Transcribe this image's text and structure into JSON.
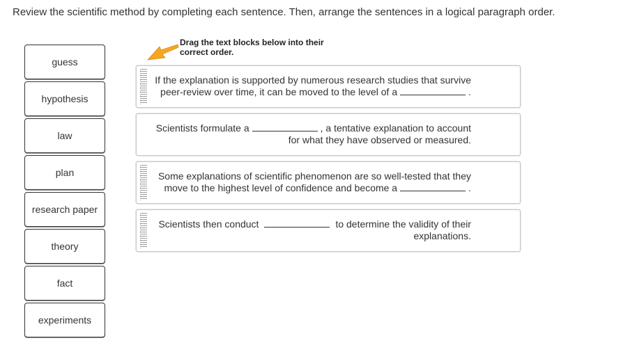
{
  "instructions": "Review the scientific method by completing each sentence. Then, arrange the sentences in a logical paragraph order.",
  "drag_hint": "Drag the text blocks below into their correct order.",
  "word_bank": [
    "guess",
    "hypothesis",
    "law",
    "plan",
    "research paper",
    "theory",
    "fact",
    "experiments"
  ],
  "sentences": [
    {
      "line1_before": "If the explanation is supported by numerous research studies that survive",
      "line2_before": "peer-review over time, it can be moved to the level of a",
      "line2_after": "."
    },
    {
      "line1_before": "Scientists formulate a",
      "line1_after": ", a tentative explanation to account",
      "line2_before": "for what they have observed or measured."
    },
    {
      "line1_before": "Some explanations of scientific phenomenon are so well-tested that they",
      "line2_before": "move to the highest level of confidence and become a",
      "line2_after": "."
    },
    {
      "line1_before": "Scientists then conduct",
      "line1_after": "to determine the validity of their",
      "line2_before": "explanations."
    }
  ],
  "colors": {
    "arrow": "#f5a623",
    "border": "#333333",
    "sentence_border": "#c8c8c8"
  }
}
